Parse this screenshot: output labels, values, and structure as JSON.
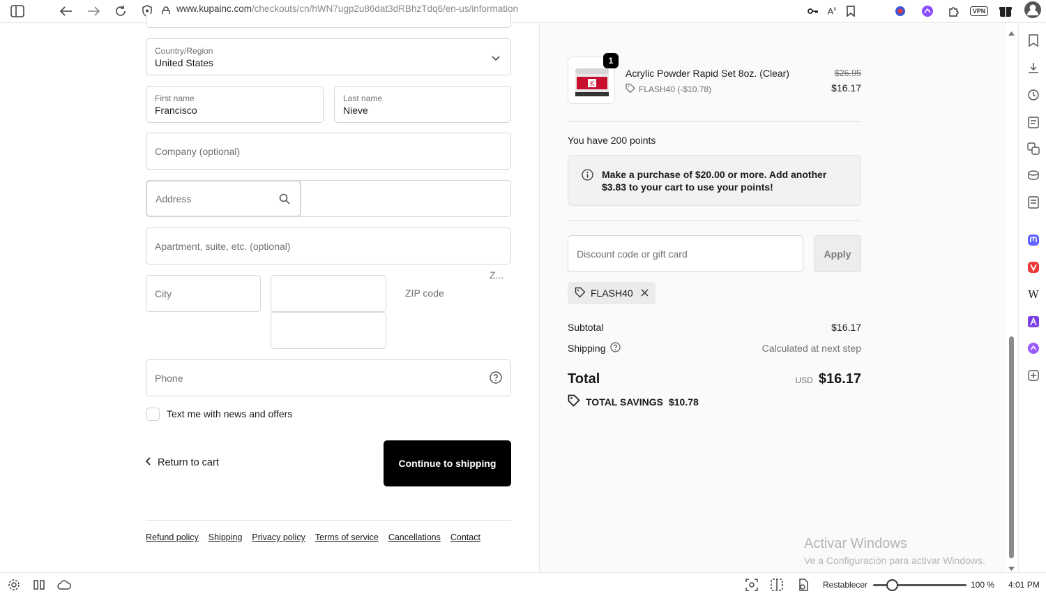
{
  "browser": {
    "url_host": "www.kupainc.com",
    "url_path": "/checkouts/cn/hWN7ugp2u86dat3dRBhzTdq6/en-us/information",
    "zoom_label": "Restablecer",
    "zoom_percent": "100 %",
    "time": "4:01 PM",
    "vpn_label": "VPN"
  },
  "form": {
    "country_label": "Country/Region",
    "country_value": "United States",
    "first_name_label": "First name",
    "first_name_value": "Francisco",
    "last_name_label": "Last name",
    "last_name_value": "Nieve",
    "company_placeholder": "Company (optional)",
    "address_placeholder": "Address",
    "apartment_placeholder": "Apartment, suite, etc. (optional)",
    "city_placeholder": "City",
    "zip_placeholder": "ZIP code",
    "zip_truncated": "Z...",
    "phone_placeholder": "Phone",
    "sms_optin_label": "Text me with news and offers",
    "return_label": "Return to cart",
    "continue_label": "Continue to shipping"
  },
  "footer": {
    "links": [
      "Refund policy",
      "Shipping",
      "Privacy policy",
      "Terms of service",
      "Cancellations",
      "Contact"
    ]
  },
  "order": {
    "item": {
      "quantity": "1",
      "title": "Acrylic Powder Rapid Set 8oz. (Clear)",
      "discount": "FLASH40 (-$10.78)",
      "original_price": "$26.95",
      "price": "$16.17"
    },
    "points_text": "You have 200 points",
    "points_notice": "Make a purchase of $20.00 or more. Add another $3.83 to your cart to use your points!",
    "discount_placeholder": "Discount code or gift card",
    "apply_label": "Apply",
    "applied_code": "FLASH40",
    "subtotal_label": "Subtotal",
    "subtotal_value": "$16.17",
    "shipping_label": "Shipping",
    "shipping_value": "Calculated at next step",
    "total_label": "Total",
    "currency": "USD",
    "total_value": "$16.17",
    "savings_label": "TOTAL SAVINGS",
    "savings_value": "$10.78"
  },
  "watermark": {
    "title": "Activar Windows",
    "subtitle": "Ve a Configuración para activar Windows."
  }
}
